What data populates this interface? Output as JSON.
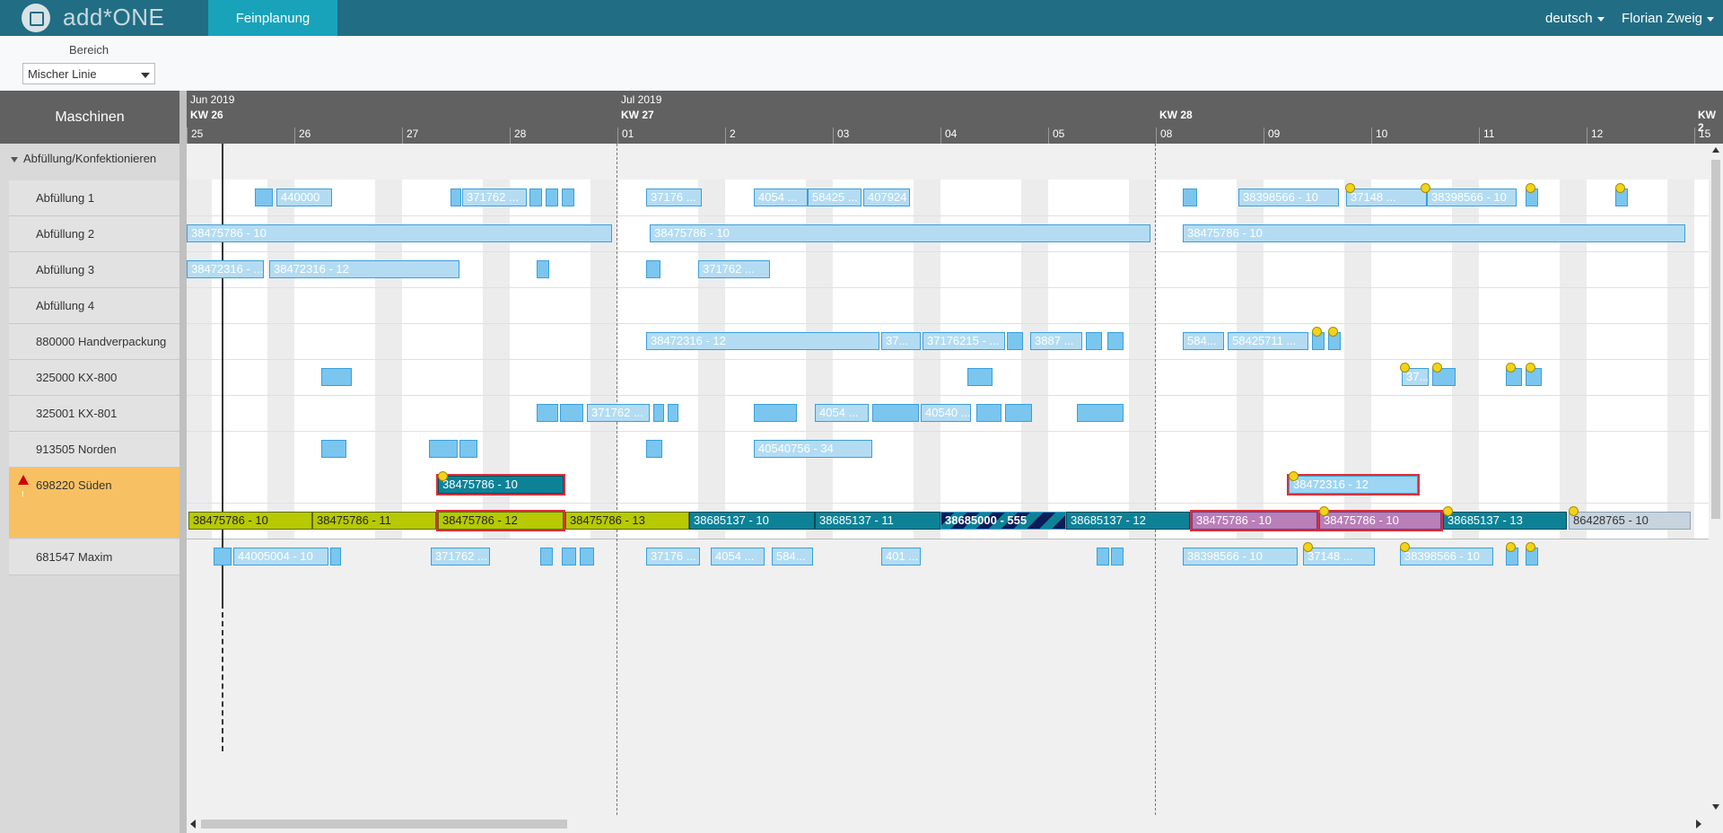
{
  "app": {
    "brand": "add*ONE",
    "active_tab": "Feinplanung"
  },
  "header": {
    "language": "deutsch",
    "user": "Florian Zweig"
  },
  "filter": {
    "label": "Bereich",
    "value": "Mischer Linie"
  },
  "machines_header": "Maschinen",
  "group": {
    "label": "Abfüllung/Konfektionieren"
  },
  "machines": [
    {
      "name": "Abfüllung 1"
    },
    {
      "name": "Abfüllung 2"
    },
    {
      "name": "Abfüllung 3"
    },
    {
      "name": "Abfüllung 4"
    },
    {
      "name": "880000 Handverpackung"
    },
    {
      "name": "325000 KX-800"
    },
    {
      "name": "325001 KX-801"
    },
    {
      "name": "913505 Norden"
    },
    {
      "name": "698220 Süden",
      "warning": true
    },
    {
      "name": "681547 Maxim"
    }
  ],
  "timeline": {
    "months": [
      "Jun 2019",
      "Jul 2019"
    ],
    "weeks": [
      "KW 26",
      "KW 27",
      "KW 28",
      "KW 2"
    ],
    "days": [
      "25",
      "26",
      "27",
      "28",
      "01",
      "2",
      "03",
      "04",
      "05",
      "08",
      "09",
      "10",
      "11",
      "12",
      "15"
    ]
  },
  "bars": {
    "r1": [
      "440000",
      "371762 ...",
      "37176 ...",
      "4054 ...",
      "58425 ...",
      "407924",
      "38398566 - 10",
      "37148 ...",
      "38398566 - 10"
    ],
    "r2": [
      "38475786 - 10",
      "38475786 - 10",
      "38475786 - 10"
    ],
    "r3": [
      "38472316 - ...",
      "38472316 - 12",
      "371762 ..."
    ],
    "r5": [
      "38472316 - 12",
      "37...",
      "37176215 - ...",
      "3887 ...",
      "584...",
      "58425711 ..."
    ],
    "r6": [
      "37..."
    ],
    "r7": [
      "371762 ...",
      "4054 ...",
      "40540 ..."
    ],
    "r8": [
      "40540756 - 34"
    ],
    "r9a": [
      "38475786 - 10",
      "38472316 - 12"
    ],
    "r9b": [
      "38475786 - 10",
      "38475786 - 11",
      "38475786 - 12",
      "38475786 - 13",
      "38685137 - 10",
      "38685137 - 11",
      "38685000 - 555",
      "38685137 - 12",
      "38475786 - 10",
      "38475786 - 10",
      "38685137 - 13",
      "86428765 - 10"
    ],
    "r10": [
      "44005004 - 10",
      "371762 ...",
      "37176 ...",
      "4054 ...",
      "584...",
      "401 ...",
      "38398566 - 10",
      "37148 ...",
      "38398566 - 10"
    ]
  }
}
